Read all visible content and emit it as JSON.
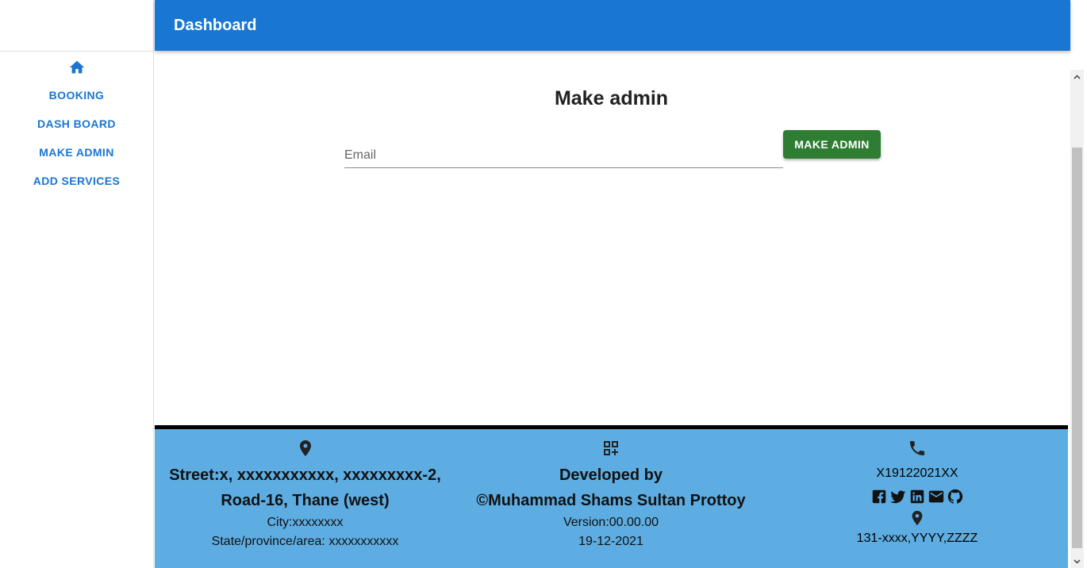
{
  "appbar": {
    "title": "Dashboard"
  },
  "sidebar": {
    "home_icon": "home-icon",
    "items": [
      {
        "label": "BOOKING"
      },
      {
        "label": "DASH BOARD"
      },
      {
        "label": "MAKE ADMIN"
      },
      {
        "label": "ADD SERVICES"
      }
    ]
  },
  "main": {
    "heading": "Make admin",
    "email_placeholder": "Email",
    "email_value": "",
    "submit_label": "MAKE ADMIN"
  },
  "footer": {
    "address": {
      "icon": "location-pin-icon",
      "line1": "Street:x, xxxxxxxxxxx, xxxxxxxxx-2,",
      "line2": "Road-16, Thane (west)",
      "city": "City:xxxxxxxx",
      "state": "State/province/area: xxxxxxxxxxx"
    },
    "developer": {
      "icon": "qr-code-icon",
      "line1": "Developed by",
      "line2": "©Muhammad Shams Sultan Prottoy",
      "version": "Version:00.00.00",
      "date": "19-12-2021"
    },
    "contact": {
      "icon": "phone-icon",
      "phone": "X19122021XX",
      "socials": [
        "facebook-icon",
        "twitter-icon",
        "linkedin-icon",
        "email-icon",
        "github-icon"
      ],
      "location_icon": "location-pin-icon",
      "address": "131-xxxx,YYYY,ZZZZ"
    }
  },
  "colors": {
    "primary": "#1976d2",
    "success": "#2e7d32",
    "footer_bg": "#5dade2",
    "footer_border": "#000000"
  }
}
